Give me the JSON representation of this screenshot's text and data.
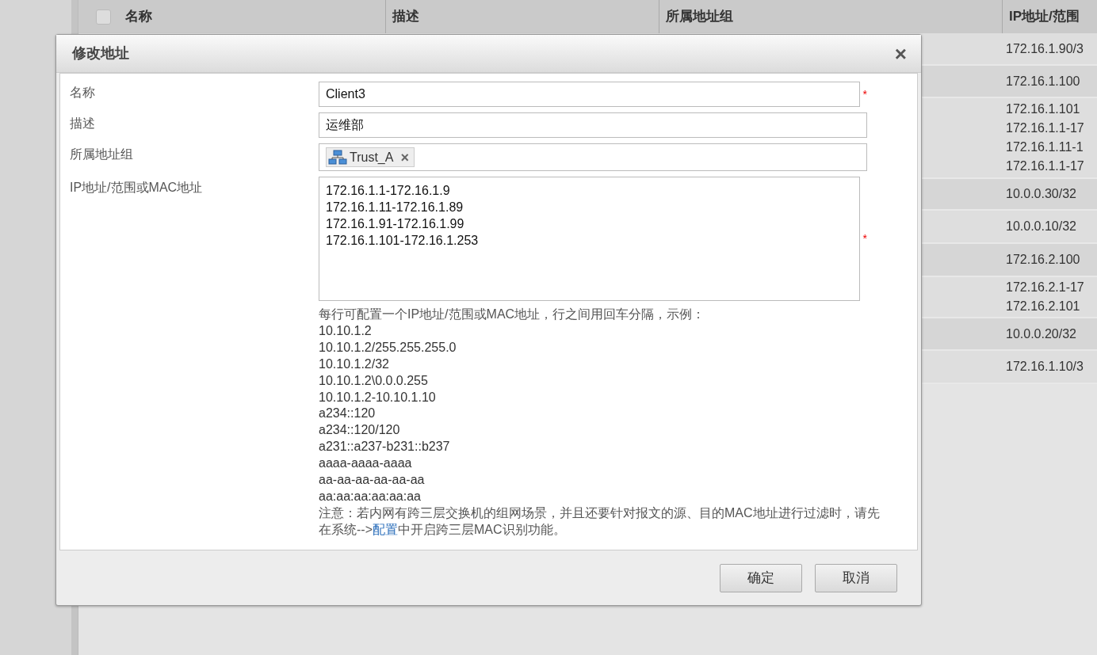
{
  "table": {
    "columns": [
      "名称",
      "描述",
      "所属地址组",
      "IP地址/范围"
    ],
    "select_all_checked": false,
    "rows": [
      {
        "ip_lines": [
          "172.16.1.90/3"
        ]
      },
      {
        "ip_lines": [
          "172.16.1.100"
        ]
      },
      {
        "ip_lines": [
          "172.16.1.101",
          "172.16.1.1-17",
          "172.16.1.11-1",
          "172.16.1.1-17"
        ]
      },
      {
        "ip_lines": [
          "10.0.0.30/32"
        ]
      },
      {
        "ip_lines": [
          "10.0.0.10/32"
        ]
      },
      {
        "ip_lines": [
          "172.16.2.100"
        ]
      },
      {
        "ip_lines": [
          "172.16.2.1-17",
          "172.16.2.101"
        ]
      },
      {
        "ip_lines": [
          "10.0.0.20/32"
        ]
      },
      {
        "ip_lines": [
          "172.16.1.10/3"
        ]
      }
    ]
  },
  "dialog": {
    "title": "修改地址",
    "close": "×",
    "fields": [
      {
        "kind": "text",
        "label": "名称",
        "value": "Client3",
        "required_mark": "*"
      },
      {
        "kind": "text",
        "label": "描述",
        "value": "运维部"
      },
      {
        "kind": "tags",
        "label": "所属地址组",
        "tags": [
          {
            "label": "Trust_A",
            "remove": "×"
          }
        ]
      },
      {
        "kind": "textarea",
        "label": "IP地址/范围或MAC地址",
        "lines": [
          "172.16.1.1-172.16.1.9",
          "172.16.1.11-172.16.1.89",
          "172.16.1.91-172.16.1.99",
          "172.16.1.101-172.16.1.253"
        ],
        "required_mark": "*"
      }
    ],
    "help_intro": "每行可配置一个IP地址/范围或MAC地址，行之间用回车分隔，示例：",
    "examples": [
      "10.10.1.2",
      "10.10.1.2/255.255.255.0",
      "10.10.1.2/32",
      "10.10.1.2\\0.0.0.255",
      "10.10.1.2-10.10.1.10",
      "a234::120",
      "a234::120/120",
      "a231::a237-b231::b237",
      "aaaa-aaaa-aaaa",
      "aa-aa-aa-aa-aa-aa",
      "aa:aa:aa:aa:aa:aa"
    ],
    "note": {
      "before": "注意：若内网有跨三层交换机的组网场景，并且还要针对报文的源、目的MAC地址进行过滤时，请先在系统-->",
      "link": "配置",
      "after": "中开启跨三层MAC识别功能。"
    },
    "buttons": [
      "确定",
      "取消"
    ]
  }
}
